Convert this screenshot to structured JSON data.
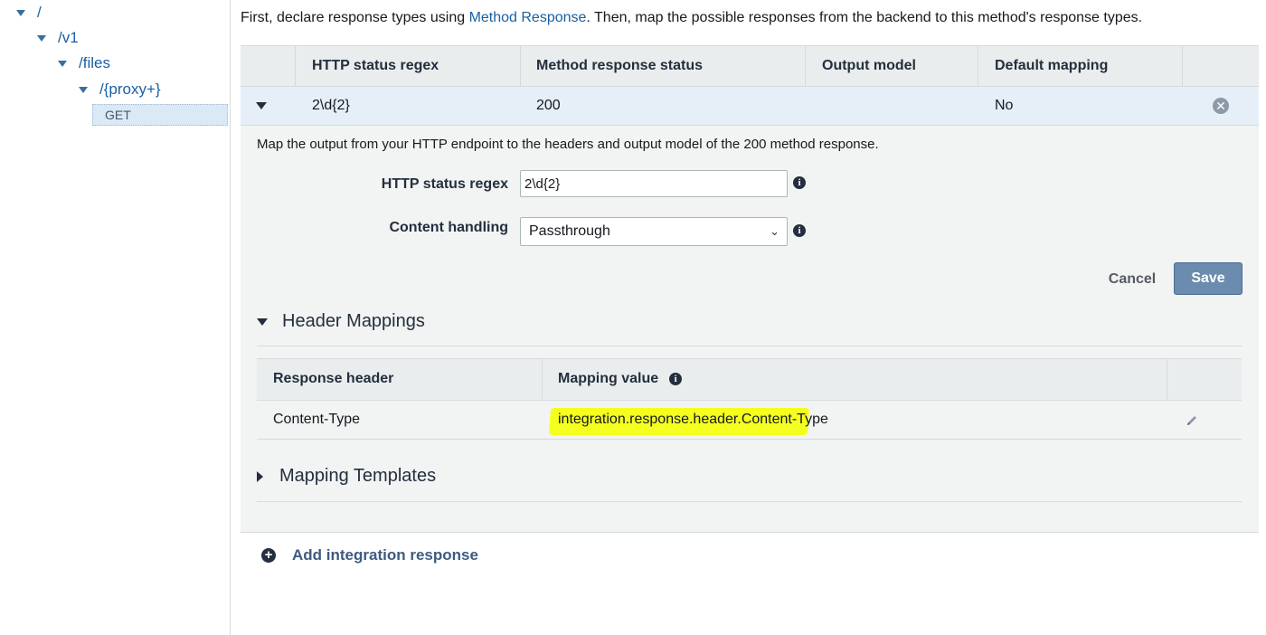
{
  "tree": {
    "root": "/",
    "v1": "/v1",
    "files": "/files",
    "proxy": "/{proxy+}",
    "method": "GET"
  },
  "intro": {
    "before": "First, declare response types using ",
    "link": "Method Response",
    "after": ". Then, map the possible responses from the backend to this method's response types."
  },
  "responses_table": {
    "columns": [
      "HTTP status regex",
      "Method response status",
      "Output model",
      "Default mapping"
    ],
    "row": {
      "regex": "2\\d{2}",
      "status": "200",
      "output_model": "",
      "default_mapping": "No"
    }
  },
  "detail": {
    "description": "Map the output from your HTTP endpoint to the headers and output model of the 200 method response.",
    "regex_label": "HTTP status regex",
    "regex_value": "2\\d{2}",
    "content_label": "Content handling",
    "content_value": "Passthrough",
    "cancel": "Cancel",
    "save": "Save"
  },
  "header_mappings": {
    "title": "Header Mappings",
    "columns": [
      "Response header",
      "Mapping value"
    ],
    "rows": [
      {
        "header": "Content-Type",
        "value": "integration.response.header.Content-Type"
      }
    ]
  },
  "mapping_templates": {
    "title": "Mapping Templates"
  },
  "add_response": "Add integration response",
  "icons": {
    "expand": "caret-down-icon",
    "collapse": "caret-right-icon",
    "remove": "remove-circle-icon",
    "info": "info-icon",
    "edit": "pencil-icon",
    "add": "plus-circle-icon"
  },
  "colors": {
    "link": "#1b5fa3",
    "save_button": "#6b8cae",
    "highlight": "#f5ff1f",
    "selected_row": "#e6eef8"
  }
}
